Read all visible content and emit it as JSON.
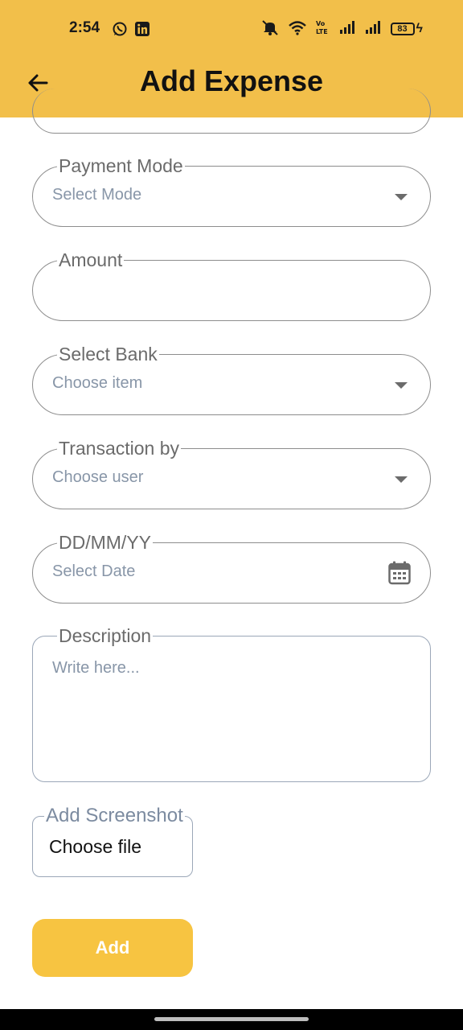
{
  "status_bar": {
    "time": "2:54",
    "battery": "83",
    "icons": [
      "whatsapp-icon",
      "linkedin-icon",
      "mute-icon",
      "wifi-icon",
      "volte-icon",
      "signal-icon",
      "signal-icon",
      "battery-icon",
      "charging-icon"
    ]
  },
  "app_bar": {
    "title": "Add Expense",
    "back_icon": "arrow-left-icon",
    "background": "#f2bf4a"
  },
  "form": {
    "payment_mode": {
      "label": "Payment Mode",
      "placeholder": "Select Mode"
    },
    "amount": {
      "label": "Amount",
      "value": ""
    },
    "bank": {
      "label": "Select Bank",
      "placeholder": "Choose item"
    },
    "transaction_by": {
      "label": "Transaction by",
      "placeholder": "Choose user"
    },
    "date": {
      "label": "DD/MM/YY",
      "placeholder": "Select Date",
      "icon": "calendar-icon"
    },
    "description": {
      "label": "Description",
      "placeholder": "Write here..."
    },
    "screenshot": {
      "label": "Add Screenshot",
      "button": "Choose file"
    }
  },
  "actions": {
    "add_label": "Add",
    "accent": "#f7c441"
  }
}
